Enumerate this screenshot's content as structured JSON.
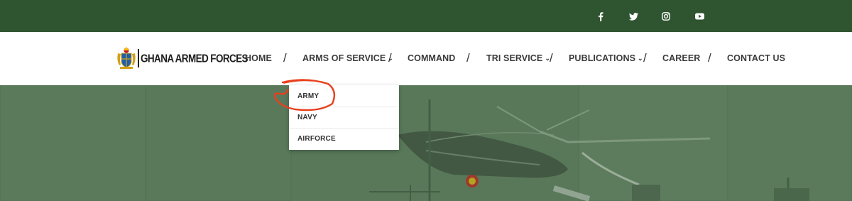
{
  "brand": {
    "name": "GHANA ARMED FORCES"
  },
  "social": [
    {
      "icon": "facebook-icon"
    },
    {
      "icon": "twitter-icon"
    },
    {
      "icon": "instagram-icon"
    },
    {
      "icon": "youtube-icon"
    }
  ],
  "nav": {
    "items": [
      {
        "label": "HOME"
      },
      {
        "label": "ARMS OF SERVICE",
        "chevron": "⌄"
      },
      {
        "label": "COMMAND"
      },
      {
        "label": "TRI SERVICE",
        "chevron": "⌄"
      },
      {
        "label": "PUBLICATIONS",
        "chevron": "⌄"
      },
      {
        "label": "CAREER"
      },
      {
        "label": "CONTACT US"
      }
    ],
    "separator": "/"
  },
  "dropdown": {
    "items": [
      {
        "label": "ARMY"
      },
      {
        "label": "NAVY"
      },
      {
        "label": "AIRFORCE"
      }
    ]
  },
  "colors": {
    "topbar": "#2e5430",
    "annotation": "#e8401e"
  }
}
